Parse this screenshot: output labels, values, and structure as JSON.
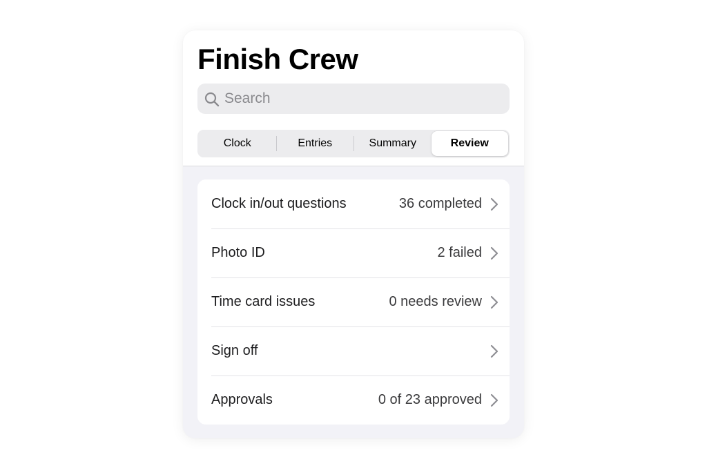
{
  "header": {
    "title": "Finish Crew"
  },
  "search": {
    "value": "",
    "placeholder": "Search",
    "icon": "search-icon"
  },
  "tabs": [
    {
      "label": "Clock",
      "selected": false
    },
    {
      "label": "Entries",
      "selected": false
    },
    {
      "label": "Summary",
      "selected": false
    },
    {
      "label": "Review",
      "selected": true
    }
  ],
  "review_items": [
    {
      "label": "Clock in/out questions",
      "value": "36 completed"
    },
    {
      "label": "Photo ID",
      "value": "2 failed"
    },
    {
      "label": "Time card issues",
      "value": "0 needs review"
    },
    {
      "label": "Sign off",
      "value": ""
    },
    {
      "label": "Approvals",
      "value": "0 of 23 approved"
    }
  ],
  "colors": {
    "background": "#f2f2f7",
    "surface": "#ffffff",
    "control_fill": "#ececee",
    "separator": "#e2e2e6",
    "chevron": "#8e8e93"
  }
}
